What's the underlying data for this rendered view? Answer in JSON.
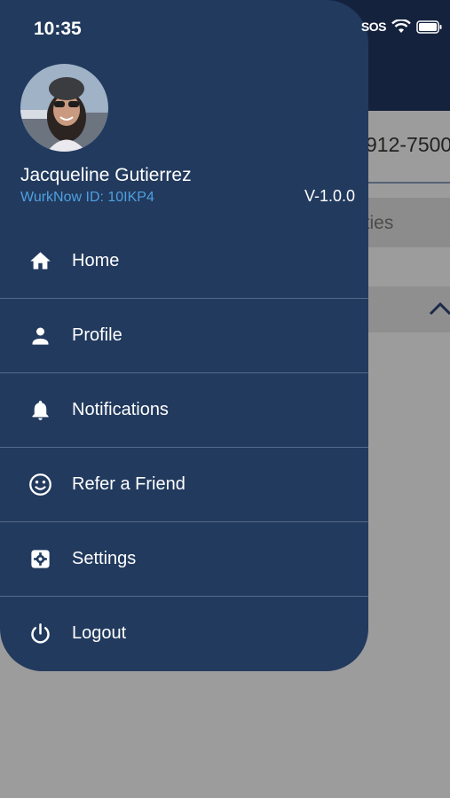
{
  "status_bar": {
    "time": "10:35",
    "carrier": "SOS"
  },
  "drawer": {
    "user_name": "Jacqueline Gutierrez",
    "user_id": "WurkNow ID: 10IKP4",
    "version": "V-1.0.0",
    "menu": [
      {
        "label": "Home",
        "icon": "home-icon"
      },
      {
        "label": "Profile",
        "icon": "person-icon"
      },
      {
        "label": "Notifications",
        "icon": "bell-icon"
      },
      {
        "label": "Refer a Friend",
        "icon": "smiley-icon"
      },
      {
        "label": "Settings",
        "icon": "gear-icon"
      },
      {
        "label": "Logout",
        "icon": "power-icon"
      }
    ]
  },
  "background": {
    "phone_partial": "912-7500",
    "field_partial": "ities"
  },
  "colors": {
    "drawer_bg": "#223a5e",
    "header_bg": "#15223d",
    "id_text": "#4fa0e0",
    "overlay": "#9b9b9b"
  }
}
